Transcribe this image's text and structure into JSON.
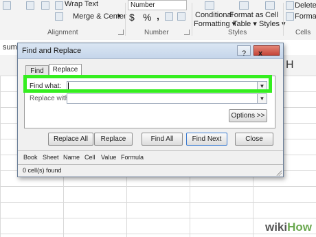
{
  "ribbon": {
    "wrap_text": "Wrap Text",
    "merge_center": "Merge & Center",
    "merge_arrow": "▾",
    "alignment_group": "Alignment",
    "number_format": "Number",
    "currency": "$",
    "percent": "%",
    "comma": ",",
    "number_group": "Number",
    "conditional_formatting_line1": "Conditional",
    "conditional_formatting_line2": "Formatting ▾",
    "format_as_table_line1": "Format as",
    "format_as_table_line2": "Table ▾",
    "cell_styles_line1": "Cell",
    "cell_styles_line2": "Styles ▾",
    "styles_group": "Styles",
    "delete": "Delete",
    "format": "Format",
    "cells_group": "Cells"
  },
  "formula_bar": {
    "name_box": "sum"
  },
  "column_header_partial": "H",
  "dialog": {
    "title": "Find and Replace",
    "help_button": "?",
    "close_button": "x",
    "tabs": [
      {
        "label": "Find"
      },
      {
        "label": "Replace"
      }
    ],
    "find_what_label": "Find what:",
    "find_what_value": "",
    "replace_with_label": "Replace with:",
    "replace_with_value": "",
    "options_button": "Options >>",
    "buttons": {
      "replace_all": "Replace All",
      "replace": "Replace",
      "find_all": "Find All",
      "find_next": "Find Next",
      "close": "Close"
    },
    "columns": [
      "Book",
      "Sheet",
      "Name",
      "Cell",
      "Value",
      "Formula"
    ],
    "status": "0 cell(s) found"
  },
  "watermark": {
    "wiki": "wiki",
    "how": "How"
  },
  "colors": {
    "highlight": "#35ee20",
    "title_bar": "#c5d5ea",
    "wiki_text": "#555555",
    "how_text": "#6aa84f"
  }
}
